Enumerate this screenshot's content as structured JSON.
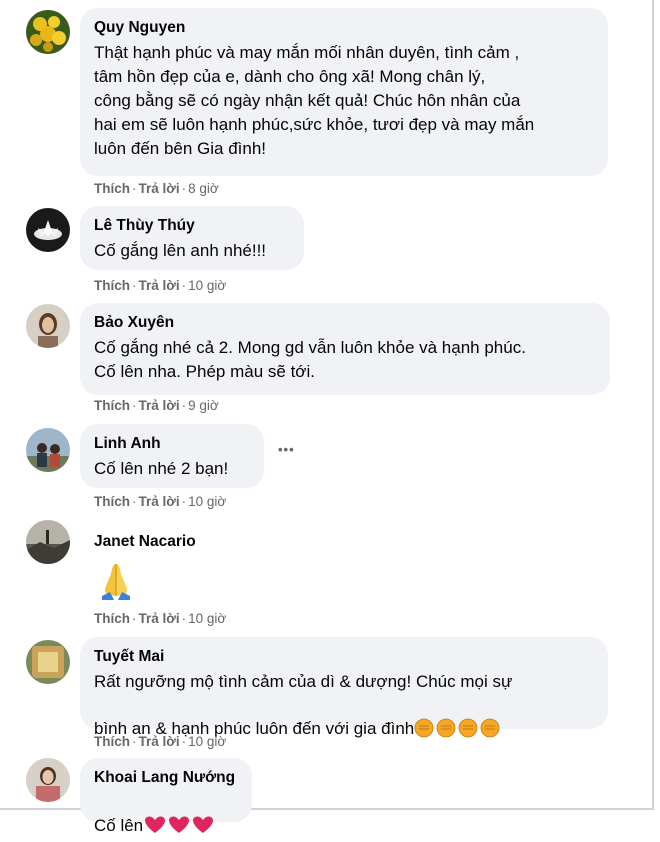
{
  "comments": [
    {
      "author": "Quy Nguyen",
      "text": "Thật hạnh phúc và may mắn mối nhân duyên, tình cảm ,\ntâm hồn đẹp của e, dành cho ông xã! Mong chân lý,\ncông bằng sẽ có ngày nhận kết quả! Chúc hôn nhân của\nhai em sẽ luôn hạnh phúc,sức khỏe, tươi đẹp và may mắn\nluôn đến bên Gia đình!",
      "like": "Thích",
      "reply": "Trả lời",
      "time": "8 giờ"
    },
    {
      "author": "Lê Thùy Thúy",
      "text": "Cố gắng lên anh nhé!!!",
      "like": "Thích",
      "reply": "Trả lời",
      "time": "10 giờ"
    },
    {
      "author": "Bảo Xuyên",
      "text": "Cố gắng nhé cả 2. Mong gd vẫn luôn khỏe và hạnh phúc.\nCố lên nha. Phép màu sẽ tới.",
      "like": "Thích",
      "reply": "Trả lời",
      "time": "9 giờ"
    },
    {
      "author": "Linh Anh",
      "text": "Cố lên nhé 2 bạn!",
      "like": "Thích",
      "reply": "Trả lời",
      "time": "10 giờ",
      "more": "•••"
    },
    {
      "author": "Janet Nacario",
      "text": "",
      "emoji": "folded-hands-icon",
      "like": "Thích",
      "reply": "Trả lời",
      "time": "10 giờ"
    },
    {
      "author": "Tuyết Mai",
      "text": "Rất ngưỡng mộ tình cảm của dì & dượng! Chúc mọi sự\nbình an & hạnh phúc luôn đến với gia đình",
      "emoji": "raised-fist-icon",
      "like": "Thích",
      "reply": "Trả lời",
      "time": "10 giờ"
    },
    {
      "author": "Khoai Lang Nướng",
      "text": "Cố lên",
      "emoji": "red-heart-icon"
    }
  ],
  "colors": {
    "bubble": "#f0f2f5",
    "meta": "#65676b",
    "heart": "#e0245e",
    "emoji_yellow": "#f5a623"
  }
}
